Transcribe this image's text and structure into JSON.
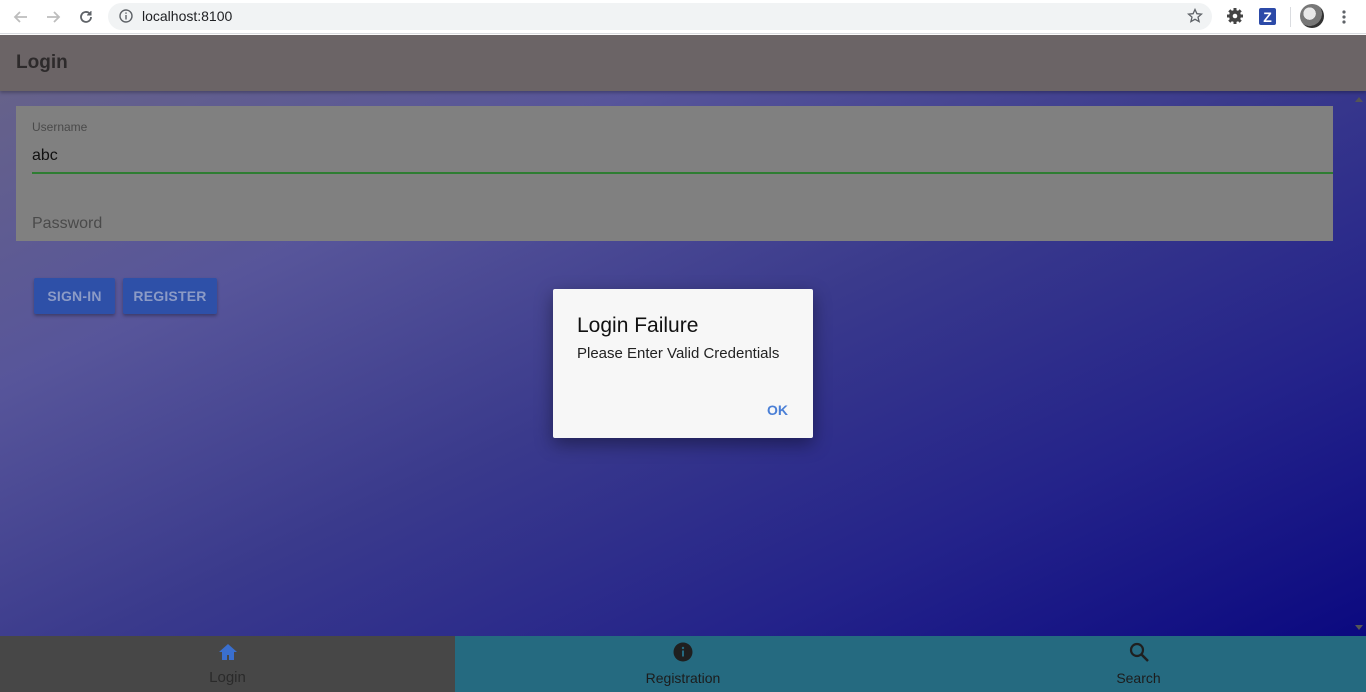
{
  "browser": {
    "url": "localhost:8100"
  },
  "app": {
    "toolbar_title": "Login",
    "username": {
      "label": "Username",
      "value": "abc"
    },
    "password": {
      "placeholder": "Password"
    },
    "buttons": {
      "sign_in": "SIGN-IN",
      "register": "REGISTER"
    },
    "tabs": [
      {
        "label": "Login",
        "icon": "home-icon",
        "active": true
      },
      {
        "label": "Registration",
        "icon": "info-icon",
        "active": false
      },
      {
        "label": "Search",
        "icon": "search-icon",
        "active": false
      }
    ]
  },
  "dialog": {
    "title": "Login Failure",
    "message": "Please Enter Valid Credentials",
    "ok_label": "OK"
  },
  "colors": {
    "toolbar": "#6b6466",
    "tabbar": "#256a80",
    "active_tab": "#474747",
    "button": "#2e50a8",
    "input_underline": "#2e7d32",
    "dialog_action": "#4a7fd6"
  }
}
